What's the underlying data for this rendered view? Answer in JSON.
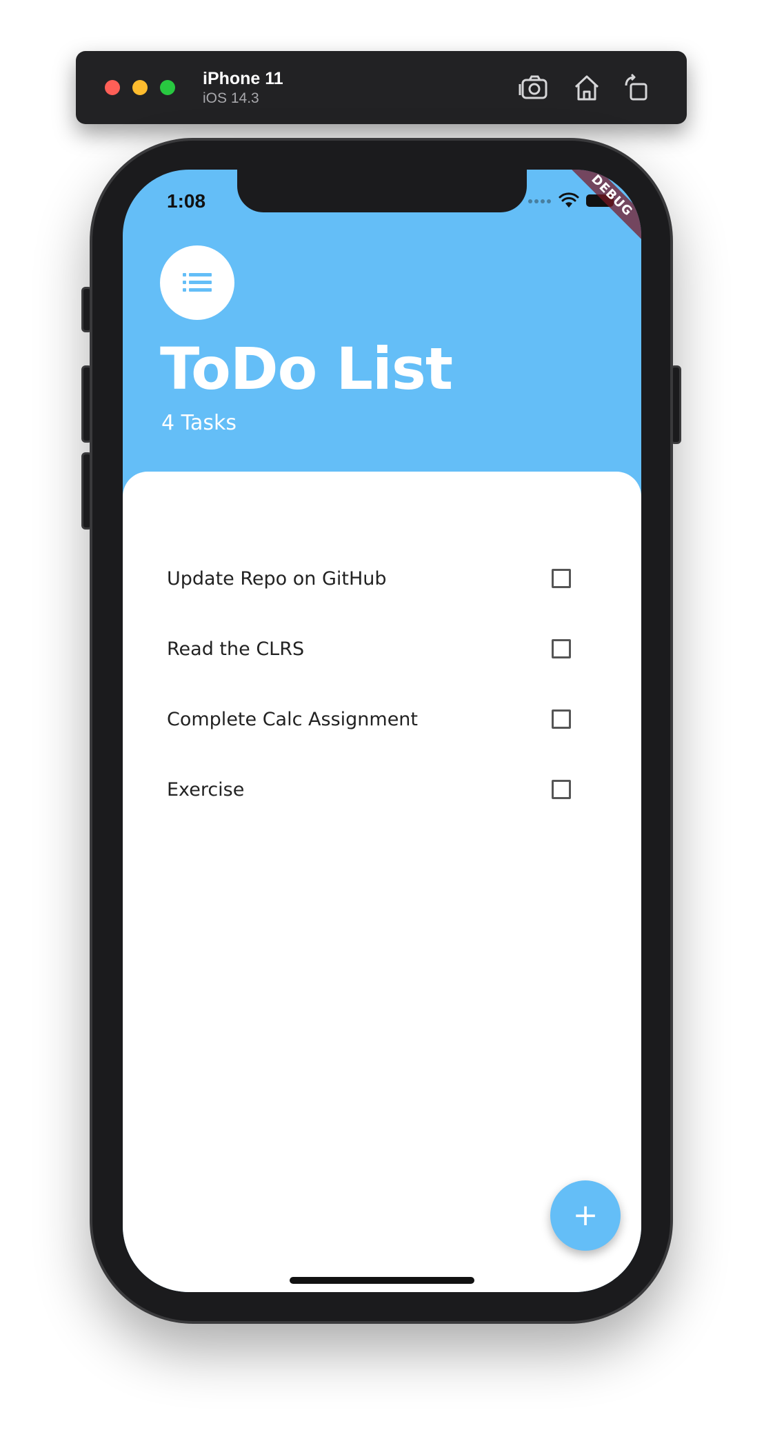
{
  "simulator": {
    "device_name": "iPhone 11",
    "os_version": "iOS 14.3",
    "traffic_lights": {
      "close": "#fe5f57",
      "minimize": "#febc2e",
      "zoom": "#28c840"
    },
    "toolbar_icons": [
      "screenshot-icon",
      "home-icon",
      "rotate-icon"
    ]
  },
  "status_bar": {
    "time": "1:08",
    "icons": [
      "signal-icon",
      "wifi-icon",
      "battery-icon"
    ]
  },
  "debug_banner": "DEBUG",
  "header": {
    "icon": "list-icon",
    "title": "ToDo List",
    "subtitle": "4 Tasks"
  },
  "tasks": [
    {
      "label": "Update Repo on GitHub",
      "checked": false
    },
    {
      "label": "Read the CLRS",
      "checked": false
    },
    {
      "label": "Complete Calc Assignment",
      "checked": false
    },
    {
      "label": "Exercise",
      "checked": false
    }
  ],
  "fab": {
    "icon": "plus-icon",
    "label": "+"
  },
  "colors": {
    "accent": "#64bef7",
    "sheet": "#ffffff",
    "text": "#222222"
  }
}
